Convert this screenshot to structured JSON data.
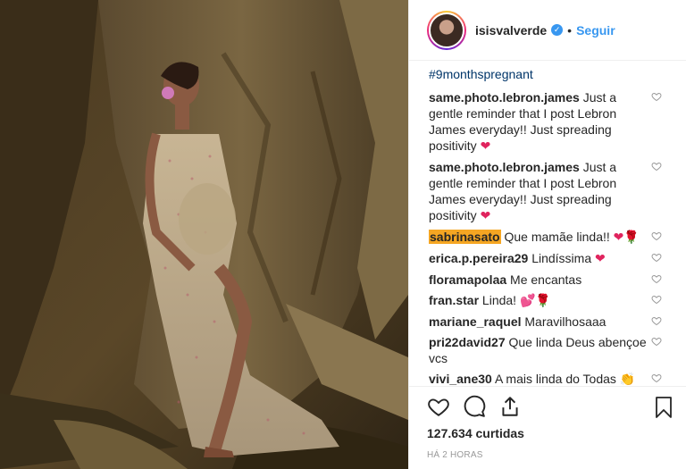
{
  "post": {
    "username": "isisvalverde",
    "separator": "•",
    "follow_label": "Seguir",
    "verified_mark": "✓"
  },
  "caption": "#9monthspregnant",
  "comments": [
    {
      "user": "same.photo.lebron.james",
      "text": "Just a gentle reminder that I post Lebron James everyday!! Just spreading positivity",
      "emoji": "❤",
      "highlight": false
    },
    {
      "user": "same.photo.lebron.james",
      "text": "Just a gentle reminder that I post Lebron James everyday!! Just spreading positivity",
      "emoji": "❤",
      "highlight": false
    },
    {
      "user": "sabrinasato",
      "text": "Que mamãe linda!!",
      "emoji": "❤🌹",
      "highlight": true
    },
    {
      "user": "erica.p.pereira29",
      "text": "Lindíssima",
      "emoji": "❤",
      "highlight": false
    },
    {
      "user": "floramapolaa",
      "text": "Me encantas",
      "emoji": "",
      "highlight": false
    },
    {
      "user": "fran.star",
      "text": "Linda!",
      "emoji": "💕🌹",
      "highlight": false
    },
    {
      "user": "mariane_raquel",
      "text": "Maravilhosaaa",
      "emoji": "",
      "highlight": false
    },
    {
      "user": "pri22david27",
      "text": "Que linda Deus abençoe vcs",
      "emoji": "",
      "highlight": false
    },
    {
      "user": "vivi_ane30",
      "text": "A mais linda do Todas",
      "emoji": "👏 👏😍😘",
      "highlight": false
    }
  ],
  "likes": "127.634 curtidas",
  "time": "HÁ 2 HORAS",
  "icons": {
    "like": "heart-icon",
    "comment": "comment-icon",
    "share": "share-icon",
    "save": "bookmark-icon",
    "comment_like": "heart-icon"
  },
  "colors": {
    "link": "#3897f0",
    "hashtag": "#003569",
    "highlight": "#f5a623",
    "muted": "#999999"
  }
}
